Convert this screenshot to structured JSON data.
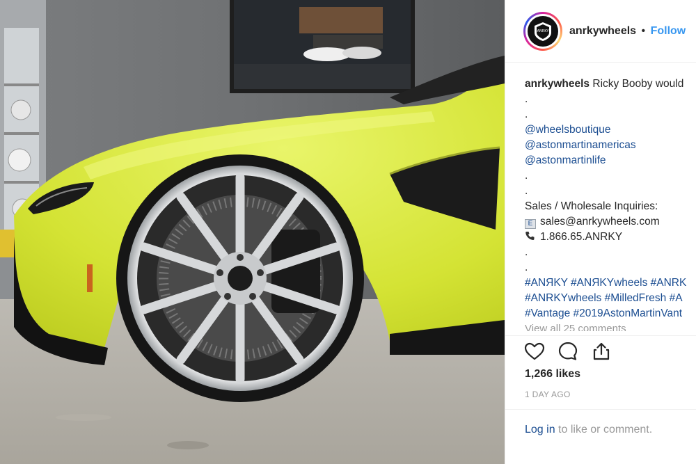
{
  "post": {
    "username": "anrkywheels",
    "separator": "•",
    "follow_label": "Follow",
    "avatar_text": "ANRKY",
    "caption_user": "anrkywheels",
    "caption_text": "Ricky Booby would",
    "caption_lines": [
      ".",
      ".",
      "@wheelsboutique",
      "@astonmartinamericas",
      "@astonmartinlife",
      ".",
      ".",
      "Sales / Wholesale Inquiries:",
      "sales@anrkywheels.com",
      "1.866.65.ANRKY",
      ".",
      ".",
      "#ANЯKY #ANЯKYwheels #ANRK",
      "#ANRKYwheels #MilledFresh #A",
      "#Vantage #2019AstonMartinVant"
    ],
    "email_icon": "e-mail-icon",
    "phone_icon": "telephone-icon",
    "view_all": "View all 25 comments",
    "likes": "1,266 likes",
    "date": "1 DAY AGO",
    "login_link": "Log in",
    "login_rest": " to like or comment."
  },
  "colors": {
    "link": "#1b4d91",
    "follow": "#3897f0",
    "muted": "#999999",
    "car_body": "#d7e63a"
  },
  "icons": [
    "heart-icon",
    "comment-icon",
    "share-icon"
  ]
}
